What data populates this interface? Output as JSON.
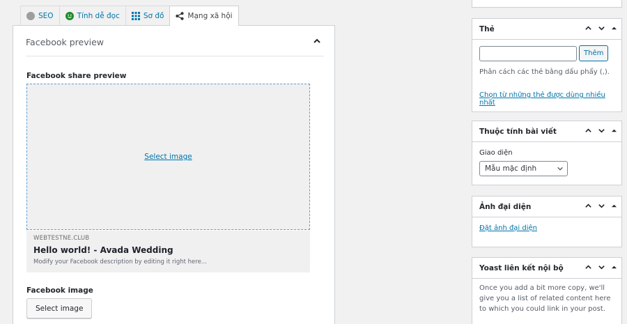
{
  "tabs": [
    {
      "label": "SEO",
      "icon": "gray-dot-icon"
    },
    {
      "label": "Tính dễ đọc",
      "icon": "smiley-icon"
    },
    {
      "label": "Sơ đồ",
      "icon": "grid-icon"
    },
    {
      "label": "Mạng xã hội",
      "icon": "share-icon"
    }
  ],
  "facebook": {
    "section_title": "Facebook preview",
    "share_preview_label": "Facebook share preview",
    "select_image_link": "Select image",
    "domain": "WEBTESTNE.CLUB",
    "post_title": "Hello world! - Avada Wedding",
    "description": "Modify your Facebook description by editing it right here...",
    "image_label": "Facebook image",
    "select_image_button": "Select image"
  },
  "sidebar": {
    "tags": {
      "title": "Thẻ",
      "add_button": "Thêm",
      "input_value": "",
      "help": "Phân cách các thẻ bằng dấu phẩy (,).",
      "most_used_link": "Chọn từ những thẻ được dùng nhiều nhất"
    },
    "post_attributes": {
      "title": "Thuộc tính bài viết",
      "template_label": "Giao diện",
      "template_value": "Mẫu mặc định"
    },
    "featured_image": {
      "title": "Ảnh đại diện",
      "set_link": "Đặt ảnh đại diện"
    },
    "yoast_links": {
      "title": "Yoast liên kết nội bộ",
      "text": "Once you add a bit more copy, we'll give you a list of related content here to which you could link in your post."
    }
  },
  "colors": {
    "link": "#0073aa",
    "seo_dot": "#9e9e9e",
    "readability_dot": "#1e8c2c"
  }
}
